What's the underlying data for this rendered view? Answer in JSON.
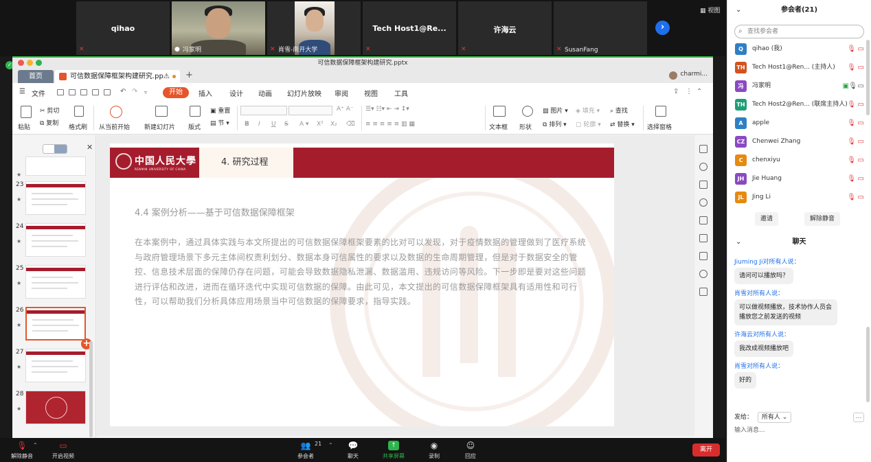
{
  "video_strip": {
    "tiles": [
      {
        "name": "qihao",
        "label": ""
      },
      {
        "name": "",
        "label": "冯家明"
      },
      {
        "name": "",
        "label": "肖雪-南开大学"
      },
      {
        "name": "Tech  Host1@Re...",
        "label": ""
      },
      {
        "name": "许海云",
        "label": ""
      },
      {
        "name": "",
        "label": "SusanFang"
      }
    ],
    "view_label": "视图"
  },
  "participants_panel": {
    "title": "参会者(21)",
    "search_placeholder": "查找参会者",
    "participants": [
      {
        "initials": "Q",
        "name": "qihao (我)",
        "role": "",
        "color": "#2f7fc4"
      },
      {
        "initials": "TH",
        "name": "Tech Host1@Ren...",
        "role": "(主持人)",
        "color": "#d1531f"
      },
      {
        "initials": "冯",
        "name": "冯家明",
        "role": "",
        "color": "#8b49c2"
      },
      {
        "initials": "TH",
        "name": "Tech Host2@Ren...",
        "role": "(联席主持人)",
        "color": "#1f9e77"
      },
      {
        "initials": "A",
        "name": "apple",
        "role": "",
        "color": "#2f7fc4"
      },
      {
        "initials": "CZ",
        "name": "Chenwei Zhang",
        "role": "",
        "color": "#8b49c2"
      },
      {
        "initials": "C",
        "name": "chenxiyu",
        "role": "",
        "color": "#e68a10"
      },
      {
        "initials": "JH",
        "name": "Jie Huang",
        "role": "",
        "color": "#8b49c2"
      },
      {
        "initials": "JL",
        "name": "Jing Li",
        "role": "",
        "color": "#e68a10"
      }
    ],
    "invite_label": "邀请",
    "unmute_all_label": "解除静音"
  },
  "chat": {
    "title": "聊天",
    "messages": [
      {
        "sender": "Jiuming Ji对所有人说：",
        "text": "请问可以播放吗？"
      },
      {
        "sender": "肖雪对所有人说：",
        "text": "可以做视频播放，技术协作人员会播放您之前发送的视频"
      },
      {
        "sender": "许海云对所有人说：",
        "text": "我改成视频播放吧"
      },
      {
        "sender": "肖雪对所有人说：",
        "text": "好的"
      }
    ],
    "send_to_label": "发给：",
    "send_to_value": "所有人",
    "input_placeholder": "输入消息..."
  },
  "wps": {
    "window_title": "可信数据保障框架构建研究.pptx",
    "home_tab": "首页",
    "file_tab": "可信数据保障框架构建研究.pp⚠",
    "user": "charmi...",
    "menu": {
      "file": "文件",
      "start": "开始",
      "insert": "插入",
      "design": "设计",
      "animation": "动画",
      "slideshow": "幻灯片放映",
      "review": "审阅",
      "view": "视图",
      "tools": "工具"
    },
    "ribbon": {
      "paste": "粘贴",
      "cut": "剪切",
      "copy": "复制",
      "format_painter": "格式刷",
      "play_from_current": "从当前开始",
      "new_slide": "新建幻灯片",
      "layout": "版式",
      "reset": "重置",
      "section": "节",
      "textbox": "文本框",
      "shape": "形状",
      "picture": "图片",
      "arrange": "排列",
      "fill": "填充",
      "outline": "轮廓",
      "find": "查找",
      "replace": "替换",
      "select_pane": "选择窗格"
    },
    "slide_numbers": [
      "23",
      "24",
      "25",
      "26",
      "27",
      "28"
    ],
    "slide": {
      "logo_text": "中国人民大學",
      "logo_sub": "RENMIN UNIVERSITY OF CHINA",
      "section": "4. 研究过程",
      "subtitle": "4.4 案例分析——基于可信数据保障框架",
      "body": "在本案例中，通过具体实践与本文所提出的可信数据保障框架要素的比对可以发现，对于疫情数据的管理做到了医疗系统与政府管理场景下多元主体间权责利划分、数据本身可信属性的要求以及数据的生命周期管理，但是对于数据安全的管控、信息技术层面的保障仍存在问题，可能会导致数据隐私泄漏、数据滥用、违规访问等风险。下一步即是要对这些问题进行评估和改进，进而在循环迭代中实现可信数据的保障。由此可见，本文提出的可信数据保障框架具有适用性和可行性，可以帮助我们分析具体应用场景当中可信数据的保障要求，指导实践。"
    }
  },
  "bottom_bar": {
    "unmute": "解除静音",
    "start_video": "开启视频",
    "participants": "参会者",
    "participants_count": "21",
    "chat": "聊天",
    "share": "共享屏幕",
    "record": "录制",
    "reactions": "回应",
    "end": "离开"
  }
}
